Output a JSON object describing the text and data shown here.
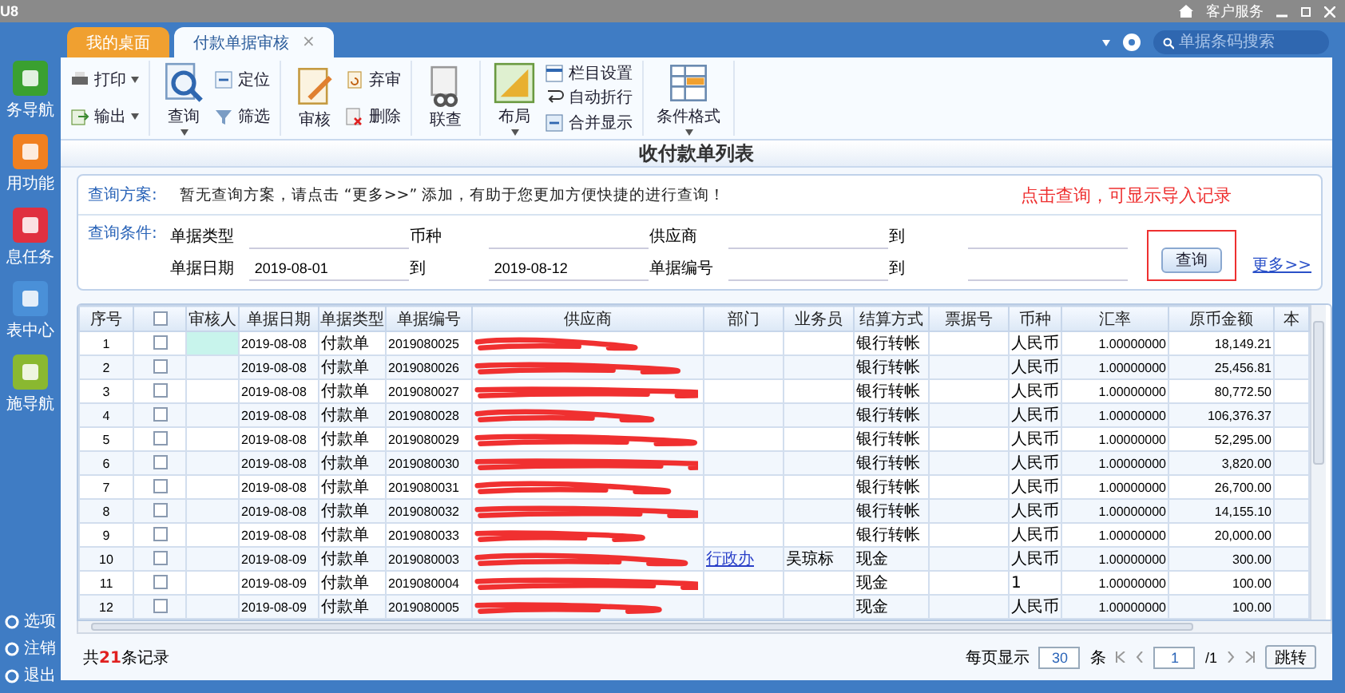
{
  "window": {
    "title": "U8",
    "service": "客户服务"
  },
  "tabs": [
    {
      "label": "我的桌面",
      "selected": false
    },
    {
      "label": "付款单据审核",
      "selected": true,
      "close": "×"
    }
  ],
  "search": {
    "placeholder": "单据条码搜索"
  },
  "sidebar": {
    "items": [
      {
        "label": "务导航"
      },
      {
        "label": "用功能"
      },
      {
        "label": "息任务"
      },
      {
        "label": "表中心"
      },
      {
        "label": "施导航"
      }
    ],
    "bottom_items": [
      {
        "label": "选项"
      },
      {
        "label": "注销"
      },
      {
        "label": "退出"
      }
    ]
  },
  "toolbar": [
    {
      "items": [
        {
          "label": "打印",
          "kind": "small",
          "dropdown": true
        },
        {
          "label": "输出",
          "kind": "small",
          "dropdown": true
        }
      ]
    },
    {
      "items": [
        {
          "label": "查询",
          "kind": "large",
          "dropdown": true
        },
        {
          "label": "定位",
          "kind": "small",
          "dropdown": false
        },
        {
          "label": "筛选",
          "kind": "small",
          "dropdown": false
        }
      ]
    },
    {
      "items": [
        {
          "label": "审核",
          "kind": "large",
          "dropdown": false
        },
        {
          "label": "弃审",
          "kind": "small",
          "dropdown": false
        },
        {
          "label": "删除",
          "kind": "small",
          "dropdown": false
        }
      ]
    },
    {
      "items": [
        {
          "label": "联查",
          "kind": "large",
          "dropdown": false
        }
      ]
    },
    {
      "items": [
        {
          "label": "布局",
          "kind": "large",
          "dropdown": true
        },
        {
          "label": "栏目设置",
          "kind": "small",
          "dropdown": false
        },
        {
          "label": "自动折行",
          "kind": "small",
          "dropdown": false
        },
        {
          "label": "合并显示",
          "kind": "small",
          "dropdown": false
        }
      ]
    },
    {
      "items": [
        {
          "label": "条件格式",
          "kind": "large",
          "dropdown": true
        }
      ]
    }
  ],
  "heading": "收付款单列表",
  "query": {
    "scheme_label": "查询方案:",
    "scheme_text": "暂无查询方案，请点击 “更多>>” 添加，有助于您更加方便快捷的进行查询！",
    "annotation": "点击查询，可显示导入记录",
    "condition_label": "查询条件:",
    "fields": [
      {
        "label": "单据类型"
      },
      {
        "label": "币种"
      },
      {
        "label": "供应商"
      },
      {
        "label": "到"
      },
      {
        "label": "单据日期",
        "value": "2019-08-01"
      },
      {
        "label": "到",
        "value": "2019-08-12"
      },
      {
        "label": "单据编号"
      },
      {
        "label": "到"
      }
    ],
    "button": "查询",
    "more": "更多>>"
  },
  "table": {
    "columns": [
      {
        "kind": "text",
        "label": "序号"
      },
      {
        "kind": "checkbox",
        "checked": false
      },
      {
        "kind": "text",
        "label": "审核人"
      },
      {
        "kind": "text",
        "label": "单据日期"
      },
      {
        "kind": "text",
        "label": "单据类型"
      },
      {
        "kind": "text",
        "label": "单据编号"
      },
      {
        "kind": "text",
        "label": "供应商"
      },
      {
        "kind": "text",
        "label": "部门"
      },
      {
        "kind": "text",
        "label": "业务员"
      },
      {
        "kind": "text",
        "label": "结算方式"
      },
      {
        "kind": "text",
        "label": "票据号"
      },
      {
        "kind": "text",
        "label": "币种"
      },
      {
        "kind": "text",
        "label": "汇率"
      },
      {
        "kind": "text",
        "label": "原币金额"
      },
      {
        "kind": "text",
        "label": "本"
      }
    ],
    "rows": [
      {
        "no": "1",
        "checked": false,
        "selected": true,
        "date": "2019-08-08",
        "type": "付款单",
        "number": "2019080025",
        "supplier_redacted": true,
        "settlement": "银行转帐",
        "currency": "人民币",
        "rate": "1.00000000",
        "amount": "18,149.21"
      },
      {
        "no": "2",
        "checked": false,
        "selected": false,
        "date": "2019-08-08",
        "type": "付款单",
        "number": "2019080026",
        "supplier_redacted": true,
        "settlement": "银行转帐",
        "currency": "人民币",
        "rate": "1.00000000",
        "amount": "25,456.81"
      },
      {
        "no": "3",
        "checked": false,
        "selected": false,
        "date": "2019-08-08",
        "type": "付款单",
        "number": "2019080027",
        "supplier_redacted": true,
        "settlement": "银行转帐",
        "currency": "人民币",
        "rate": "1.00000000",
        "amount": "80,772.50"
      },
      {
        "no": "4",
        "checked": false,
        "selected": false,
        "date": "2019-08-08",
        "type": "付款单",
        "number": "2019080028",
        "supplier_redacted": true,
        "settlement": "银行转帐",
        "currency": "人民币",
        "rate": "1.00000000",
        "amount": "106,376.37"
      },
      {
        "no": "5",
        "checked": false,
        "selected": false,
        "date": "2019-08-08",
        "type": "付款单",
        "number": "2019080029",
        "supplier_redacted": true,
        "settlement": "银行转帐",
        "currency": "人民币",
        "rate": "1.00000000",
        "amount": "52,295.00"
      },
      {
        "no": "6",
        "checked": false,
        "selected": false,
        "date": "2019-08-08",
        "type": "付款单",
        "number": "2019080030",
        "supplier_redacted": true,
        "settlement": "银行转帐",
        "currency": "人民币",
        "rate": "1.00000000",
        "amount": "3,820.00"
      },
      {
        "no": "7",
        "checked": false,
        "selected": false,
        "date": "2019-08-08",
        "type": "付款单",
        "number": "2019080031",
        "supplier_redacted": true,
        "settlement": "银行转帐",
        "currency": "人民币",
        "rate": "1.00000000",
        "amount": "26,700.00"
      },
      {
        "no": "8",
        "checked": false,
        "selected": false,
        "date": "2019-08-08",
        "type": "付款单",
        "number": "2019080032",
        "supplier_redacted": true,
        "settlement": "银行转帐",
        "currency": "人民币",
        "rate": "1.00000000",
        "amount": "14,155.10"
      },
      {
        "no": "9",
        "checked": false,
        "selected": false,
        "date": "2019-08-08",
        "type": "付款单",
        "number": "2019080033",
        "supplier_redacted": true,
        "settlement": "银行转帐",
        "currency": "人民币",
        "rate": "1.00000000",
        "amount": "20,000.00"
      },
      {
        "no": "10",
        "checked": false,
        "selected": false,
        "date": "2019-08-09",
        "type": "付款单",
        "number": "2019080003",
        "supplier_redacted": true,
        "department": "行政办",
        "salesperson": "吴琼标",
        "settlement": "现金",
        "currency": "人民币",
        "rate": "1.00000000",
        "amount": "300.00"
      },
      {
        "no": "11",
        "checked": false,
        "selected": false,
        "date": "2019-08-09",
        "type": "付款单",
        "number": "2019080004",
        "supplier_redacted": true,
        "settlement": "现金",
        "currency": "1",
        "rate": "1.00000000",
        "amount": "100.00"
      },
      {
        "no": "12",
        "checked": false,
        "selected": false,
        "date": "2019-08-09",
        "type": "付款单",
        "number": "2019080005",
        "supplier_redacted": true,
        "settlement": "现金",
        "currency": "人民币",
        "rate": "1.00000000",
        "amount": "100.00"
      }
    ]
  },
  "footer": {
    "total": "共**21**条记录",
    "per_page_label": "每页显示",
    "per_page": "30",
    "unit": "条",
    "page": "1",
    "pages": "/1",
    "jump": "跳转"
  }
}
